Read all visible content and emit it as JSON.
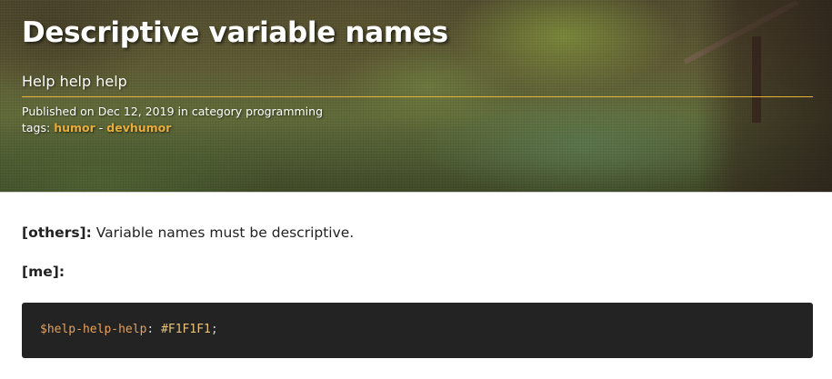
{
  "header": {
    "title": "Descriptive variable names",
    "subtitle": "Help help help",
    "published_prefix": "Published on",
    "date": "Dec 12, 2019",
    "category_prefix": "in category",
    "category": "programming",
    "tags_label": "tags:",
    "tags": [
      "humor",
      "devhumor"
    ],
    "tag_separator": "-"
  },
  "body": {
    "line1_speaker": "[others]:",
    "line1_text": "Variable names must be descriptive.",
    "line2_speaker": "[me]:"
  },
  "code": {
    "variable": "$help-help-help",
    "colon": ":",
    "value": "#F1F1F1",
    "semicolon": ";"
  },
  "colors": {
    "accent": "#e8ac3a",
    "code_background": "#232323",
    "header_divider": "#e5b33c"
  }
}
